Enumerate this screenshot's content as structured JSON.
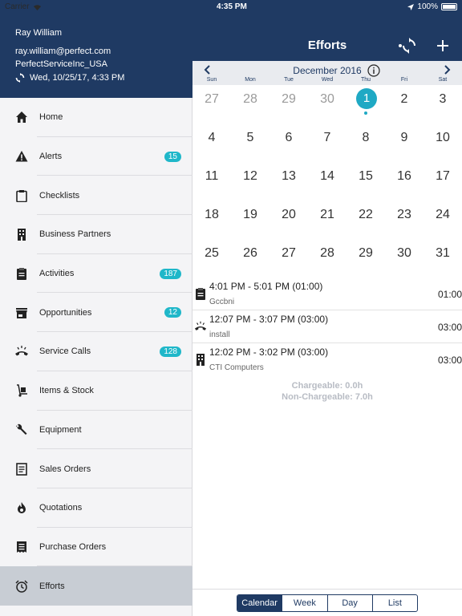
{
  "status_bar": {
    "carrier": "Carrier",
    "time": "4:35 PM",
    "battery": "100%"
  },
  "profile": {
    "name": "Ray William",
    "email": "ray.william@perfect.com",
    "org": "PerfectServiceInc_USA",
    "last_sync": "Wed, 10/25/17, 4:33 PM"
  },
  "menu": [
    {
      "label": "Home",
      "icon": "home-icon"
    },
    {
      "label": "Alerts",
      "icon": "alert-icon",
      "badge": "15"
    },
    {
      "label": "Checklists",
      "icon": "clipboard-icon"
    },
    {
      "label": "Business Partners",
      "icon": "building-icon"
    },
    {
      "label": "Activities",
      "icon": "activity-clipboard-icon",
      "badge": "187"
    },
    {
      "label": "Opportunities",
      "icon": "storefront-icon",
      "badge": "12"
    },
    {
      "label": "Service Calls",
      "icon": "phone-ringing-icon",
      "badge": "128"
    },
    {
      "label": "Items & Stock",
      "icon": "hand-truck-icon"
    },
    {
      "label": "Equipment",
      "icon": "wrench-icon"
    },
    {
      "label": "Sales Orders",
      "icon": "document-icon"
    },
    {
      "label": "Quotations",
      "icon": "flame-icon"
    },
    {
      "label": "Purchase Orders",
      "icon": "receipt-icon"
    },
    {
      "label": "Efforts",
      "icon": "alarm-clock-icon",
      "active": true
    }
  ],
  "header": {
    "title": "Efforts"
  },
  "calendar": {
    "month_label": "December 2016",
    "weekdays": [
      "Sun",
      "Mon",
      "Tue",
      "Wed",
      "Thu",
      "Fri",
      "Sat"
    ],
    "weeks": [
      [
        "27",
        "28",
        "29",
        "30",
        "1",
        "2",
        "3"
      ],
      [
        "4",
        "5",
        "6",
        "7",
        "8",
        "9",
        "10"
      ],
      [
        "11",
        "12",
        "13",
        "14",
        "15",
        "16",
        "17"
      ],
      [
        "18",
        "19",
        "20",
        "21",
        "22",
        "23",
        "24"
      ],
      [
        "25",
        "26",
        "27",
        "28",
        "29",
        "30",
        "31"
      ]
    ],
    "selected_day": "1"
  },
  "events": [
    {
      "time": "4:01 PM - 5:01 PM (01:00)",
      "subtitle": "Gccbni",
      "duration": "01:00",
      "icon": "clipboard-icon"
    },
    {
      "time": "12:07 PM - 3:07 PM (03:00)",
      "subtitle": "install",
      "duration": "03:00",
      "icon": "phone-ringing-icon"
    },
    {
      "time": "12:02 PM - 3:02 PM (03:00)",
      "subtitle": "CTI Computers",
      "duration": "03:00",
      "icon": "building-icon"
    }
  ],
  "summary": {
    "chargeable": "Chargeable: 0.0h",
    "non_chargeable": "Non-Chargeable: 7.0h"
  },
  "view_tabs": [
    "Calendar",
    "Week",
    "Day",
    "List"
  ],
  "selected_view": "Calendar",
  "colors": {
    "nav": "#1f3a63",
    "accent": "#1fa9c4",
    "badge": "#1fb7c9"
  }
}
